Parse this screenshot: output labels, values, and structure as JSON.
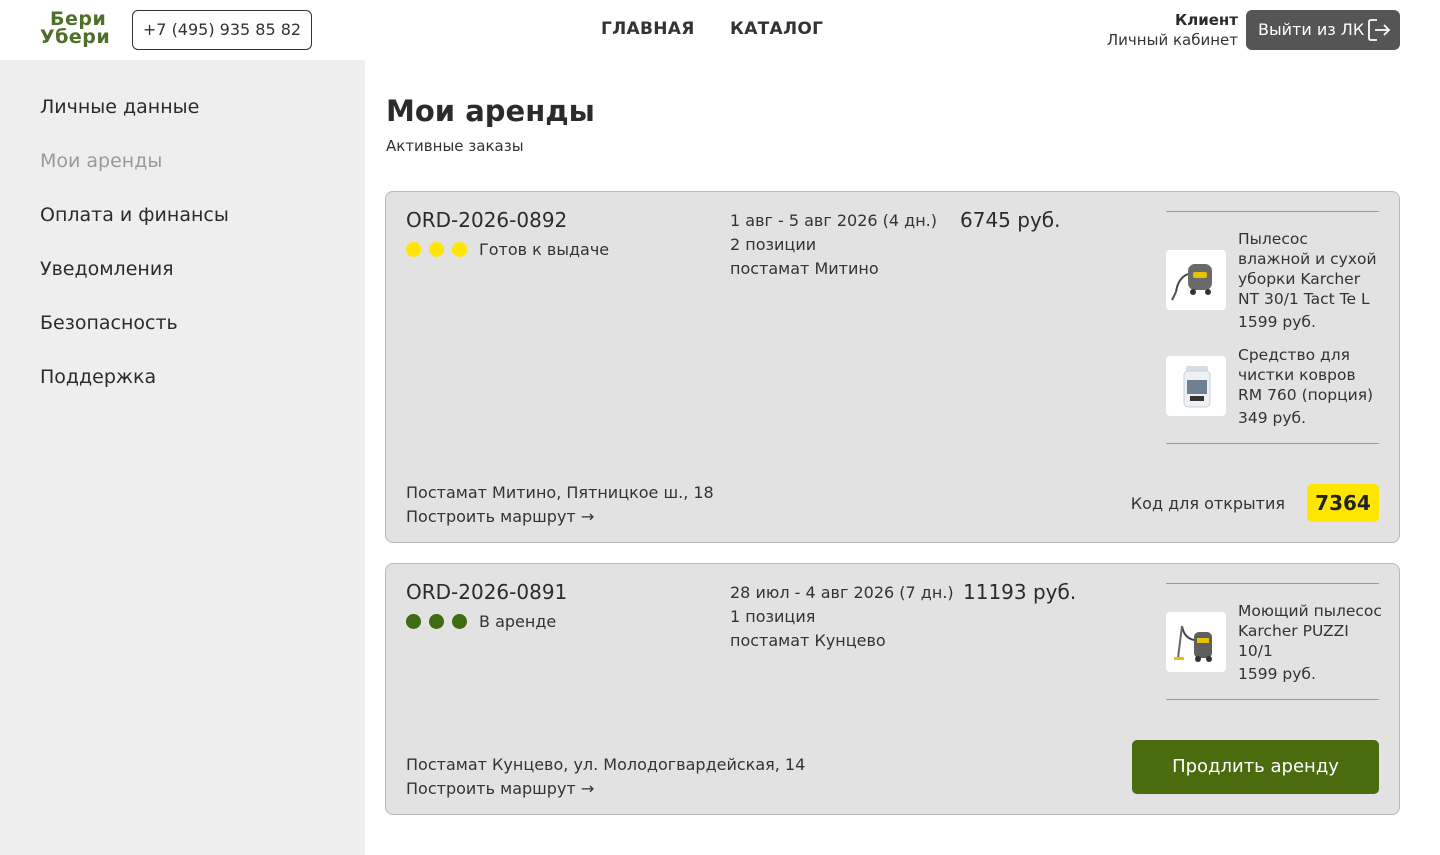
{
  "header": {
    "logo_line1": "Бери",
    "logo_line2": "Убери",
    "phone": "+7 (495) 935 85 82",
    "nav": {
      "main": "ГЛАВНАЯ",
      "catalog": "КАТАЛОГ"
    },
    "user_role": "Клиент",
    "user_cabinet": "Личный кабинет",
    "logout_label": "Выйти из ЛК",
    "logout_icon": "logout-icon"
  },
  "sidebar": {
    "items": [
      {
        "label": "Личные данные"
      },
      {
        "label": "Мои аренды",
        "active": true
      },
      {
        "label": "Оплата и финансы"
      },
      {
        "label": "Уведомления"
      },
      {
        "label": "Безопасность"
      },
      {
        "label": "Поддержка"
      }
    ]
  },
  "main": {
    "title": "Мои аренды",
    "subtitle": "Активные заказы"
  },
  "orders": [
    {
      "id": "ORD-2026-0892",
      "status": "Готов к выдаче",
      "status_color": "#ffe600",
      "dates": "1 авг - 5 авг 2026 (4 дн.)",
      "positions": "2 позиции",
      "pickup": "постамат Митино",
      "price": "6745 руб.",
      "items": [
        {
          "name": "Пылесос влажной и сухой уборки Karcher NT 30/1 Tact Te L",
          "price": "1599 руб.",
          "icon": "vacuum-cleaner-image"
        },
        {
          "name": "Средство для чистки ковров RM 760 (порция)",
          "price": "349 руб.",
          "icon": "detergent-jar-image"
        }
      ],
      "address": "Постамат Митино, Пятницкое ш., 18",
      "route": "Построить маршрут →",
      "code_label": "Код для открытия",
      "code": "7364"
    },
    {
      "id": "ORD-2026-0891",
      "status": "В аренде",
      "status_color": "#3f6b12",
      "dates": "28 июл - 4 авг 2026 (7 дн.)",
      "positions": "1 позиция",
      "pickup": "постамат Кунцево",
      "price": "11193 руб.",
      "items": [
        {
          "name": "Моющий пылесос Karcher PUZZI 10/1",
          "price": "1599 руб.",
          "icon": "washing-vacuum-image"
        }
      ],
      "address": "Постамат Кунцево, ул. Молодогвардейская, 14",
      "route": "Построить маршрут →",
      "extend_label": "Продлить аренду"
    }
  ]
}
